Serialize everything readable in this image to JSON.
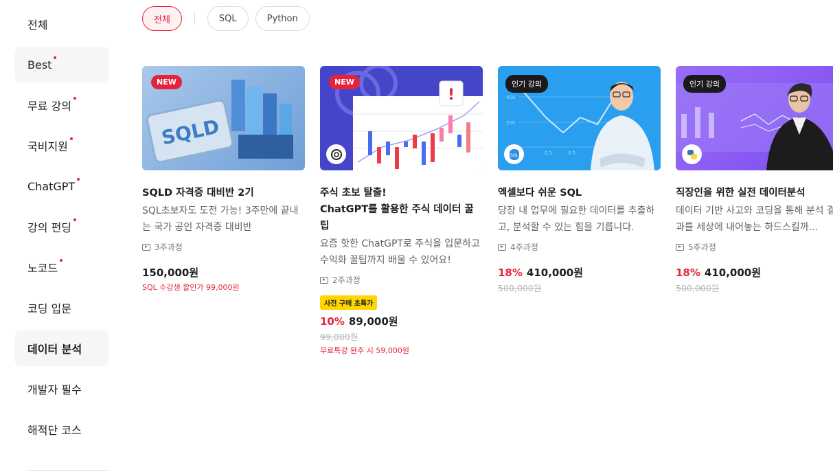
{
  "sidebar": {
    "items": [
      {
        "label": "전체",
        "dot": false
      },
      {
        "label": "Best",
        "dot": true
      },
      {
        "label": "무료 강의",
        "dot": true
      },
      {
        "label": "국비지원",
        "dot": true
      },
      {
        "label": "ChatGPT",
        "dot": true
      },
      {
        "label": "강의 펀딩",
        "dot": true
      },
      {
        "label": "노코드",
        "dot": true
      },
      {
        "label": "코딩 입문",
        "dot": false
      },
      {
        "label": "데이터 분석",
        "dot": false
      },
      {
        "label": "개발자 필수",
        "dot": false
      },
      {
        "label": "해적단 코스",
        "dot": false
      }
    ]
  },
  "filters": {
    "chips": [
      "전체",
      "SQL",
      "Python"
    ]
  },
  "cards": [
    {
      "badge": "NEW",
      "thumb_text": "SQLD",
      "title": "SQLD 자격증 대비반 2기",
      "desc": "SQL초보자도 도전 가능! 3주만에 끝내는 국가 공인 자격증 대비반",
      "lessons": "3주과정",
      "price": "150,000원",
      "note": "SQL 수강생 할인가 99,000원"
    },
    {
      "badge": "NEW",
      "title_line1": "주식 초보 탈출!",
      "title_line2": "ChatGPT를 활용한 주식 데이터 꿀팁",
      "desc": "요즘 핫한 ChatGPT로 주식을 입문하고 수익화 꿀팁까지 배울 수 있어요!",
      "lessons": "2주과정",
      "presale": "사전 구매 초특가",
      "discount": "10%",
      "price": "89,000원",
      "orig": "99,000원",
      "note": "무료특강 완주 시 59,000원"
    },
    {
      "badge": "인기 강의",
      "tool_label": "SQL",
      "chart_ticks": [
        "400",
        "200",
        "0.5",
        "0.5"
      ],
      "title": "엑셀보다 쉬운 SQL",
      "desc": "당장 내 업무에 필요한 데이터를 추출하고, 분석할 수 있는 힘을 기릅니다.",
      "lessons": "4주과정",
      "discount": "18%",
      "price": "410,000원",
      "orig": "500,000원"
    },
    {
      "badge": "인기 강의",
      "title": "직장인을 위한 실전 데이터분석",
      "desc": "데이터 기반 사고와 코딩을 통해 분석 결과를 세상에 내어놓는 하드스킬까...",
      "lessons": "5주과정",
      "discount": "18%",
      "price": "410,000원",
      "orig": "500,000원"
    }
  ],
  "colors": {
    "accent": "#e5233a",
    "presale": "#ffd600",
    "thumb1": "#7fb3e6",
    "thumb2": "#4b4bd6",
    "thumb3": "#2b9ef0",
    "thumb4": "#8b5cf6"
  }
}
